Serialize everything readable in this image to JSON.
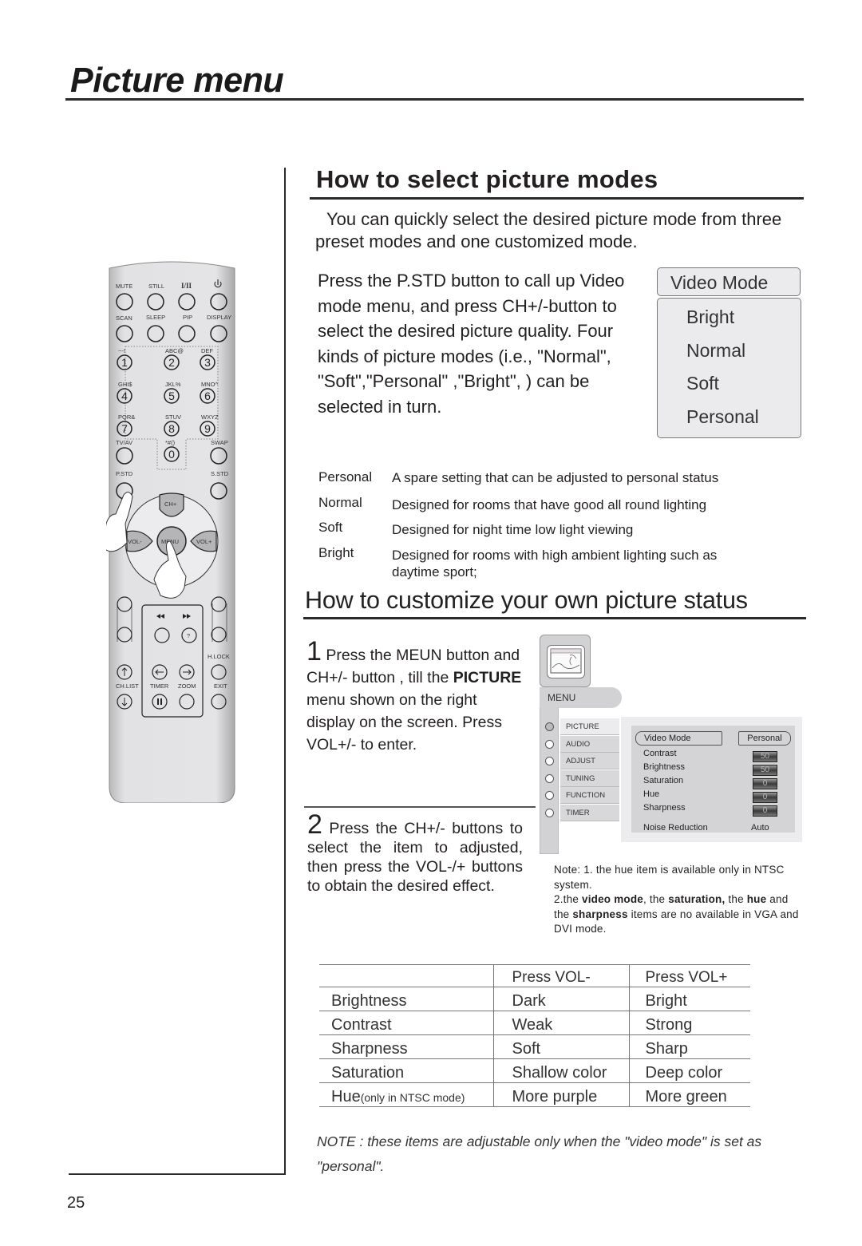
{
  "page": {
    "title": "Picture menu",
    "page_number": "25"
  },
  "remote": {
    "row1": [
      "MUTE",
      "STILL",
      "I/II",
      "power"
    ],
    "row2": [
      "SCAN",
      "SLEEP",
      "PIP",
      "DISPLAY"
    ],
    "digits": [
      {
        "digit": "1",
        "letters": "~-!"
      },
      {
        "digit": "2",
        "letters": "ABC@"
      },
      {
        "digit": "3",
        "letters": "DEF"
      },
      {
        "digit": "4",
        "letters": "GHI$"
      },
      {
        "digit": "5",
        "letters": "JKL%"
      },
      {
        "digit": "6",
        "letters": "MNO^"
      },
      {
        "digit": "7",
        "letters": "PQR&"
      },
      {
        "digit": "8",
        "letters": "STUV"
      },
      {
        "digit": "9",
        "letters": "WXYZ"
      },
      {
        "digit": "0",
        "letters": "*#()"
      }
    ],
    "tv_av": "TV/AV",
    "swap": "SWAP",
    "pstd": "P.STD",
    "sstd": "S.STD",
    "ch_plus": "CH+",
    "vol_minus": "VOL-",
    "menu": "MENU",
    "vol_plus": "VOL+",
    "hlock": "H.LOCK",
    "chlist": "CH.LIST",
    "timer": "TIMER",
    "zoom": "ZOOM",
    "exit": "EXIT"
  },
  "select_section": {
    "heading": "How to select picture modes",
    "intro": "You can quickly select the desired picture mode from three preset modes and one customized mode.",
    "instructions": "Press the P.STD  button to call up Video mode menu, and press CH+/-button to select the desired picture quality. Four  kinds of picture modes (i.e., \"Normal\", \"Soft\",\"Personal\" ,\"Bright\", ) can be selected in turn.",
    "video_mode_menu": {
      "header": "Video Mode",
      "items": [
        "Bright",
        "Normal",
        "Soft",
        "Personal"
      ]
    },
    "modes": [
      {
        "name": "Personal",
        "description": "A spare setting that can be adjusted to personal status"
      },
      {
        "name": "Normal",
        "description": "Designed for rooms that have good all round lighting"
      },
      {
        "name": "Soft",
        "description": "Designed for night time low light viewing"
      },
      {
        "name": "Bright",
        "description": "Designed for rooms with high ambient lighting such as daytime sport;"
      }
    ]
  },
  "customize_section": {
    "heading": "How to customize your own picture status",
    "step1": {
      "number": "1",
      "text_a": " Press the MEUN button and CH+/- button , till the ",
      "bold": "PICTURE",
      "text_b": " menu shown on the right display on the screen. Press VOL+/- to enter."
    },
    "step2": {
      "number": "2",
      "text": " Press the CH+/- buttons to select the item to adjusted, then press the VOL-/+ buttons to obtain the desired effect."
    },
    "osd": {
      "menu_label": "MENU",
      "sidebar": [
        "PICTURE",
        "AUDIO",
        "ADJUST",
        "TUNING",
        "FUNCTION",
        "TIMER"
      ],
      "active_index": 0,
      "video_mode_label": "Video Mode",
      "video_mode_value": "Personal",
      "rows": [
        {
          "label": "Contrast",
          "value": "50"
        },
        {
          "label": "Brightness",
          "value": "50"
        },
        {
          "label": "Saturation",
          "value": "0"
        },
        {
          "label": "Hue",
          "value": "0"
        },
        {
          "label": "Sharpness",
          "value": "0"
        }
      ],
      "noise_reduction_label": "Noise Reduction",
      "noise_reduction_value": "Auto"
    },
    "note": {
      "line1": "Note: 1. the hue item is available only in NTSC system.",
      "p2_a": "2.the ",
      "p2_b1": "video mode",
      "p2_c": ", the ",
      "p2_b2": "saturation,",
      "p2_d": " the ",
      "p2_b3": "hue",
      "p2_e": " and the ",
      "p2_b4": "sharpness",
      "p2_f": " items are no available in VGA and DVI mode."
    }
  },
  "adjust_table": {
    "headers": [
      "",
      "Press VOL-",
      "Press VOL+"
    ],
    "rows": [
      {
        "item": "Brightness",
        "note": "",
        "minus": "Dark",
        "plus": "Bright"
      },
      {
        "item": "Contrast",
        "note": "",
        "minus": "Weak",
        "plus": "Strong"
      },
      {
        "item": "Sharpness",
        "note": "",
        "minus": "Soft",
        "plus": "Sharp"
      },
      {
        "item": "Saturation",
        "note": "",
        "minus": "Shallow color",
        "plus": "Deep color"
      },
      {
        "item": "Hue",
        "note": "(only in NTSC mode)",
        "minus": "More purple",
        "plus": "More green"
      }
    ]
  },
  "footnote": "NOTE :  these items are adjustable only when the \"video mode\" is set as \"personal\"."
}
